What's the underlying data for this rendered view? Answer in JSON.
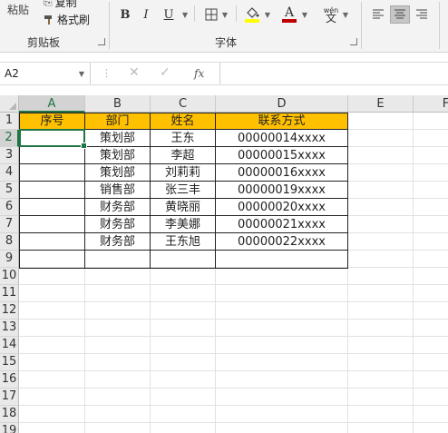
{
  "ribbon": {
    "clipboard": {
      "paste_label": "粘贴",
      "copy_label": "复制",
      "format_painter_label": "格式刷",
      "group_label": "剪贴板"
    },
    "font": {
      "bold": "B",
      "italic": "I",
      "underline": "U",
      "border_icon": "borders-icon",
      "fill_icon": "fill-color-icon",
      "font_color_icon": "font-color-icon",
      "fill_color": "#ffff00",
      "font_color": "#c00000",
      "phonetic_top": "wén",
      "phonetic_bottom": "文",
      "group_label": "字体"
    }
  },
  "formula_bar": {
    "name_box": "A2",
    "fx": "fx",
    "value": ""
  },
  "columns": [
    "A",
    "B",
    "C",
    "D",
    "E",
    "F"
  ],
  "rows": [
    "1",
    "2",
    "3",
    "4",
    "5",
    "6",
    "7",
    "8",
    "9",
    "10",
    "11",
    "12",
    "13",
    "14",
    "15",
    "16",
    "17",
    "18",
    "19"
  ],
  "table": {
    "header_fill": "#ffc000",
    "headers": [
      "序号",
      "部门",
      "姓名",
      "联系方式"
    ],
    "rows": [
      [
        "",
        "策划部",
        "王东",
        "00000014xxxx"
      ],
      [
        "",
        "策划部",
        "李超",
        "00000015xxxx"
      ],
      [
        "",
        "策划部",
        "刘莉莉",
        "00000016xxxx"
      ],
      [
        "",
        "销售部",
        "张三丰",
        "00000019xxxx"
      ],
      [
        "",
        "财务部",
        "黄晓丽",
        "00000020xxxx"
      ],
      [
        "",
        "财务部",
        "李美娜",
        "00000021xxxx"
      ],
      [
        "",
        "财务部",
        "王东旭",
        "00000022xxxx"
      ],
      [
        "",
        "",
        "",
        ""
      ]
    ]
  },
  "accent_color": "#217346"
}
